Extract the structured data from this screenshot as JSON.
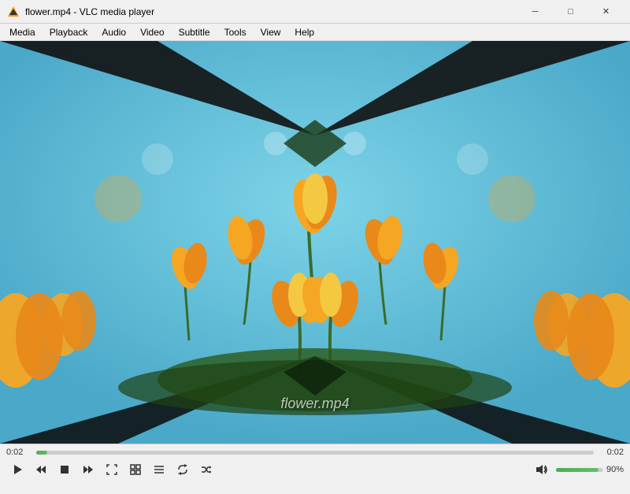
{
  "window": {
    "title": "flower.mp4 - VLC media player",
    "icon": "vlc-icon"
  },
  "titlebar": {
    "minimize_label": "─",
    "maximize_label": "□",
    "close_label": "✕"
  },
  "menubar": {
    "items": [
      {
        "label": "Media",
        "id": "media"
      },
      {
        "label": "Playback",
        "id": "playback"
      },
      {
        "label": "Audio",
        "id": "audio"
      },
      {
        "label": "Video",
        "id": "video"
      },
      {
        "label": "Subtitle",
        "id": "subtitle"
      },
      {
        "label": "Tools",
        "id": "tools"
      },
      {
        "label": "View",
        "id": "view"
      },
      {
        "label": "Help",
        "id": "help"
      }
    ]
  },
  "video": {
    "filename": "flower.mp4",
    "watermark": "flower.mp4"
  },
  "controls": {
    "time_current": "0:02",
    "time_total": "0:02",
    "progress_percent": 2,
    "volume_percent": 90,
    "volume_label": "90%",
    "buttons": {
      "play": "▶",
      "prev": "⏮",
      "stop": "⏹",
      "next": "⏭",
      "fullscreen": "⛶",
      "extended": "⊞",
      "playlist": "☰",
      "loop": "↺",
      "random": "⇄",
      "volume": "🔊"
    }
  }
}
